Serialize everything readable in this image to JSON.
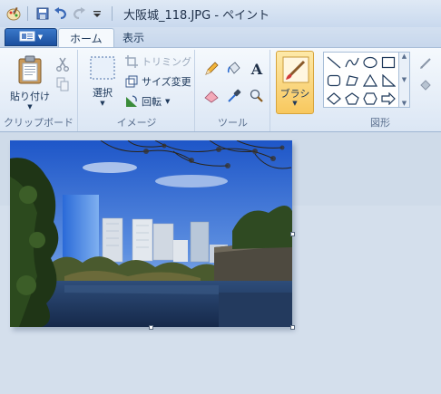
{
  "titlebar": {
    "title": "大阪城_118.JPG - ペイント",
    "app_icon": "paint-app-icon",
    "qat_items": [
      "save-icon",
      "undo-icon",
      "redo-icon",
      "customize-qat-icon"
    ]
  },
  "tabs": {
    "file_menu_icon": "file-menu-icon",
    "items": [
      {
        "label": "ホーム",
        "active": true
      },
      {
        "label": "表示",
        "active": false
      }
    ]
  },
  "ribbon": {
    "clipboard": {
      "group_label": "クリップボード",
      "paste_label": "貼り付け",
      "cut_icon": "scissors-icon",
      "copy_icon": "copy-icon"
    },
    "image": {
      "group_label": "イメージ",
      "select_label": "選択",
      "crop_label": "トリミング",
      "resize_label": "サイズ変更",
      "rotate_label": "回転"
    },
    "tools": {
      "group_label": "ツール",
      "items": [
        "pencil-icon",
        "fill-bucket-icon",
        "text-icon",
        "eraser-icon",
        "color-picker-icon",
        "magnifier-icon"
      ]
    },
    "brush": {
      "label": "ブラシ"
    },
    "shapes": {
      "group_label": "図形",
      "items": [
        "line",
        "curve",
        "oval",
        "rectangle",
        "rounded-rectangle",
        "polygon",
        "triangle",
        "right-triangle",
        "diamond",
        "pentagon",
        "hexagon",
        "right-arrow"
      ]
    }
  },
  "canvas": {
    "image_name": "大阪城_118.JPG"
  },
  "colors": {
    "ribbon_bg": "#e6eef8",
    "workspace_bg": "#cfdbe9",
    "file_tab": "#1b4f9e",
    "brush_highlight": "#f8c85e"
  }
}
